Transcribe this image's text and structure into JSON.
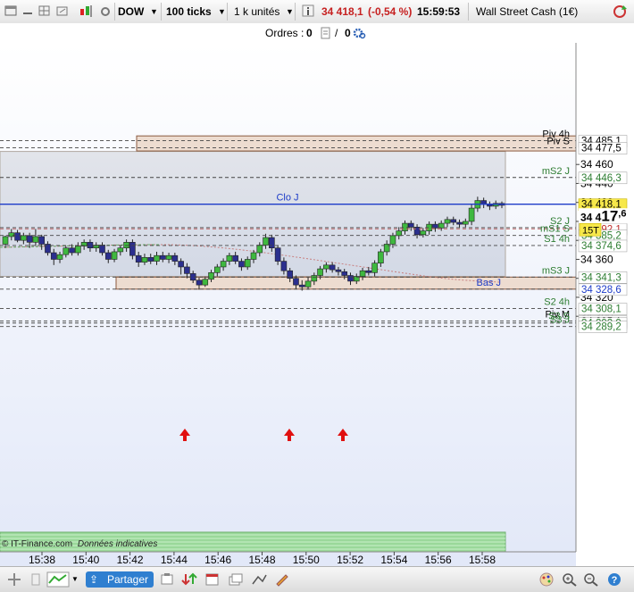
{
  "toolbar": {
    "symbol": "DOW",
    "period": "100 ticks",
    "quantity": "1 k unités",
    "price": "34 418,1",
    "change": "(-0,54 %)",
    "time": "15:59:53",
    "instrument": "Wall Street Cash (1€)"
  },
  "orders": {
    "label": "Ordres :",
    "count_a": "0",
    "count_b": "0"
  },
  "footer": {
    "copyright": "© IT-Finance.com",
    "disclaimer": "Données indicatives"
  },
  "bottombar": {
    "share_label": "Partager"
  },
  "colors": {
    "up": "#3fb83f",
    "down": "#2b2f8e",
    "zone": "#eddcd0",
    "levels": "#2e7d32",
    "close": "#1e3cc8"
  },
  "chart_data": {
    "type": "candlestick",
    "instrument": "Wall Street Cash (1€)",
    "x_ticks": [
      "15:38",
      "15:40",
      "15:42",
      "15:44",
      "15:46",
      "15:48",
      "15:50",
      "15:52",
      "15:54",
      "15:56",
      "15:58"
    ],
    "y_ticks": [
      "34 460",
      "34 440",
      "34 420",
      "34 400",
      "34 380",
      "34 360",
      "34 340",
      "34 320",
      "34 300"
    ],
    "ylim": [
      34286,
      34492
    ],
    "last_price": "34 418,1",
    "last_price_big": "34 417,6",
    "interval_label": "15T",
    "levels": [
      {
        "name": "Piv 4h",
        "value": "34 485,1"
      },
      {
        "name": "Piv S",
        "value": "34 477,5"
      },
      {
        "name": "mS2 J",
        "value": "34 446,3"
      },
      {
        "name": "Clo J",
        "value": "34 418,1"
      },
      {
        "name": "S2 J",
        "value": "34 393,4"
      },
      {
        "name": "",
        "value": "34 392,1"
      },
      {
        "name": "mS1 S",
        "value": "34 385,2"
      },
      {
        "name": "S1 4h",
        "value": "34 374,6"
      },
      {
        "name": "mS3 J",
        "value": "34 341,3"
      },
      {
        "name": "Bas J",
        "value": "34 328,6"
      },
      {
        "name": "S2 4h",
        "value": "34 308,1"
      },
      {
        "name": "Piv M",
        "value": "34 295,1"
      },
      {
        "name": "S3 S",
        "value": "34 292,9"
      },
      {
        "name": "S3 J",
        "value": "34 289,2"
      }
    ],
    "candles": [
      [
        34376,
        34384,
        34372,
        34385
      ],
      [
        34384,
        34388,
        34380,
        34392
      ],
      [
        34388,
        34380,
        34378,
        34391
      ],
      [
        34380,
        34385,
        34376,
        34388
      ],
      [
        34385,
        34378,
        34372,
        34388
      ],
      [
        34378,
        34384,
        34374,
        34392
      ],
      [
        34384,
        34376,
        34370,
        34386
      ],
      [
        34376,
        34367,
        34364,
        34379
      ],
      [
        34367,
        34360,
        34354,
        34371
      ],
      [
        34360,
        34365,
        34356,
        34368
      ],
      [
        34365,
        34372,
        34362,
        34374
      ],
      [
        34372,
        34367,
        34364,
        34376
      ],
      [
        34367,
        34374,
        34364,
        34378
      ],
      [
        34374,
        34378,
        34370,
        34381
      ],
      [
        34378,
        34372,
        34368,
        34381
      ],
      [
        34372,
        34375,
        34368,
        34378
      ],
      [
        34375,
        34367,
        34364,
        34378
      ],
      [
        34367,
        34360,
        34356,
        34370
      ],
      [
        34360,
        34368,
        34357,
        34371
      ],
      [
        34368,
        34372,
        34364,
        34375
      ],
      [
        34372,
        34378,
        34368,
        34381
      ],
      [
        34378,
        34364,
        34360,
        34381
      ],
      [
        34364,
        34357,
        34352,
        34368
      ],
      [
        34357,
        34362,
        34354,
        34366
      ],
      [
        34362,
        34358,
        34355,
        34366
      ],
      [
        34358,
        34364,
        34354,
        34368
      ],
      [
        34364,
        34360,
        34357,
        34368
      ],
      [
        34360,
        34364,
        34356,
        34367
      ],
      [
        34364,
        34358,
        34354,
        34367
      ],
      [
        34358,
        34352,
        34344,
        34361
      ],
      [
        34352,
        34345,
        34340,
        34356
      ],
      [
        34345,
        34338,
        34335,
        34348
      ],
      [
        34338,
        34333,
        34328,
        34341
      ],
      [
        34333,
        34339,
        34331,
        34342
      ],
      [
        34339,
        34346,
        34336,
        34349
      ],
      [
        34346,
        34352,
        34342,
        34355
      ],
      [
        34352,
        34358,
        34348,
        34361
      ],
      [
        34358,
        34364,
        34354,
        34367
      ],
      [
        34364,
        34358,
        34355,
        34368
      ],
      [
        34358,
        34352,
        34348,
        34361
      ],
      [
        34352,
        34360,
        34349,
        34363
      ],
      [
        34360,
        34367,
        34356,
        34370
      ],
      [
        34367,
        34375,
        34363,
        34378
      ],
      [
        34375,
        34383,
        34371,
        34387
      ],
      [
        34383,
        34372,
        34368,
        34386
      ],
      [
        34372,
        34358,
        34354,
        34375
      ],
      [
        34358,
        34348,
        34344,
        34362
      ],
      [
        34348,
        34340,
        34336,
        34351
      ],
      [
        34340,
        34333,
        34329,
        34343
      ],
      [
        34333,
        34331,
        34327,
        34338
      ],
      [
        34331,
        34337,
        34328,
        34341
      ],
      [
        34337,
        34343,
        34333,
        34346
      ],
      [
        34343,
        34350,
        34339,
        34353
      ],
      [
        34350,
        34354,
        34346,
        34357
      ],
      [
        34354,
        34349,
        34346,
        34357
      ],
      [
        34349,
        34347,
        34343,
        34352
      ],
      [
        34347,
        34343,
        34339,
        34350
      ],
      [
        34343,
        34337,
        34333,
        34346
      ],
      [
        34337,
        34342,
        34334,
        34345
      ],
      [
        34342,
        34348,
        34338,
        34351
      ],
      [
        34348,
        34346,
        34343,
        34352
      ],
      [
        34346,
        34356,
        34342,
        34359
      ],
      [
        34356,
        34368,
        34352,
        34371
      ],
      [
        34368,
        34376,
        34364,
        34380
      ],
      [
        34376,
        34385,
        34372,
        34388
      ],
      [
        34385,
        34390,
        34381,
        34394
      ],
      [
        34390,
        34398,
        34386,
        34401
      ],
      [
        34398,
        34394,
        34390,
        34401
      ],
      [
        34394,
        34386,
        34382,
        34397
      ],
      [
        34386,
        34390,
        34383,
        34393
      ],
      [
        34390,
        34397,
        34386,
        34400
      ],
      [
        34397,
        34393,
        34389,
        34400
      ],
      [
        34393,
        34398,
        34390,
        34401
      ],
      [
        34398,
        34402,
        34394,
        34405
      ],
      [
        34402,
        34399,
        34396,
        34405
      ],
      [
        34399,
        34397,
        34393,
        34402
      ],
      [
        34397,
        34400,
        34394,
        34403
      ],
      [
        34400,
        34414,
        34396,
        34418
      ],
      [
        34414,
        34422,
        34410,
        34426
      ],
      [
        34422,
        34418,
        34414,
        34425
      ],
      [
        34418,
        34416,
        34412,
        34421
      ],
      [
        34416,
        34419,
        34413,
        34422
      ],
      [
        34419,
        34417,
        34414,
        34421
      ]
    ]
  }
}
